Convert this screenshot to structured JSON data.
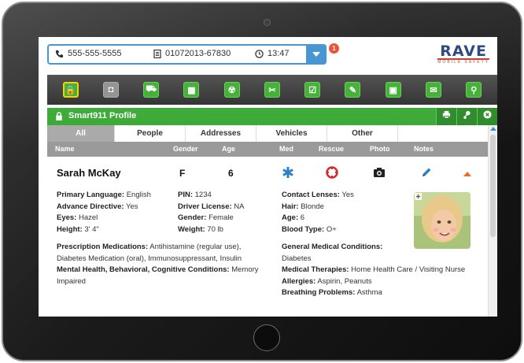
{
  "callbar": {
    "phone": "555-555-5555",
    "incident_id": "01072013-67830",
    "time": "13:47",
    "notification_count": "1"
  },
  "logo": {
    "main": "RAVE",
    "sub": "MOBILE SAFETY"
  },
  "toolbar": {
    "icons": [
      {
        "name": "lock-icon",
        "glyph": "🔒",
        "state": "selected"
      },
      {
        "name": "shield-icon",
        "glyph": "◘",
        "state": "disabled"
      },
      {
        "name": "car-icon",
        "glyph": "⛟",
        "state": "normal"
      },
      {
        "name": "building-icon",
        "glyph": "▦",
        "state": "normal"
      },
      {
        "name": "hazard-icon",
        "glyph": "☢",
        "state": "normal"
      },
      {
        "name": "pets-icon",
        "glyph": "✂",
        "state": "normal"
      },
      {
        "name": "checklist-icon",
        "glyph": "☑",
        "state": "normal"
      },
      {
        "name": "edit-icon",
        "glyph": "✎",
        "state": "normal"
      },
      {
        "name": "book-icon",
        "glyph": "▣",
        "state": "normal"
      },
      {
        "name": "chat-icon",
        "glyph": "✉",
        "state": "normal"
      },
      {
        "name": "map-pin-icon",
        "glyph": "⚲",
        "state": "normal"
      }
    ]
  },
  "profile": {
    "title": "Smart911 Profile"
  },
  "tabs": [
    "All",
    "People",
    "Addresses",
    "Vehicles",
    "Other"
  ],
  "columns": {
    "name": "Name",
    "gender": "Gender",
    "age": "Age",
    "med": "Med",
    "rescue": "Rescue",
    "photo": "Photo",
    "notes": "Notes"
  },
  "person": {
    "name": "Sarah McKay",
    "gender": "F",
    "age": "6",
    "col1": [
      {
        "label": "Primary Language:",
        "value": "English"
      },
      {
        "label": "Advance Directive:",
        "value": "Yes"
      },
      {
        "label": "Eyes:",
        "value": "Hazel"
      },
      {
        "label": "Height:",
        "value": "3' 4\""
      }
    ],
    "col2": [
      {
        "label": "PIN:",
        "value": "1234"
      },
      {
        "label": "Driver License:",
        "value": "NA"
      },
      {
        "label": "Gender:",
        "value": "Female"
      },
      {
        "label": "Weight:",
        "value": "70 lb"
      }
    ],
    "col3": [
      {
        "label": "Contact Lenses:",
        "value": "Yes"
      },
      {
        "label": "Hair:",
        "value": "Blonde"
      },
      {
        "label": "Age:",
        "value": "6"
      },
      {
        "label": "Blood Type:",
        "value": "O+"
      }
    ],
    "prescription_label": "Prescription Medications:",
    "prescription_value": "Antihistamine (regular use), Diabetes Medication (oral), Immunosuppressant, Insulin",
    "mental_label": "Mental Health, Behavioral, Cognitive Conditions:",
    "mental_value": "Memory Impaired",
    "general_label": "General Medical Conditions:",
    "general_value": "Diabetes",
    "therapies_label": "Medical Therapies:",
    "therapies_value": "Home Health Care / Visiting Nurse",
    "allergies_label": "Allergies:",
    "allergies_value": "Aspirin, Peanuts",
    "breathing_label": "Breathing Problems:",
    "breathing_value": "Asthma"
  },
  "colors": {
    "accent_blue": "#3b8fd0",
    "green": "#3aa935",
    "notif_red": "#e8462a",
    "orange": "#f06a22"
  }
}
